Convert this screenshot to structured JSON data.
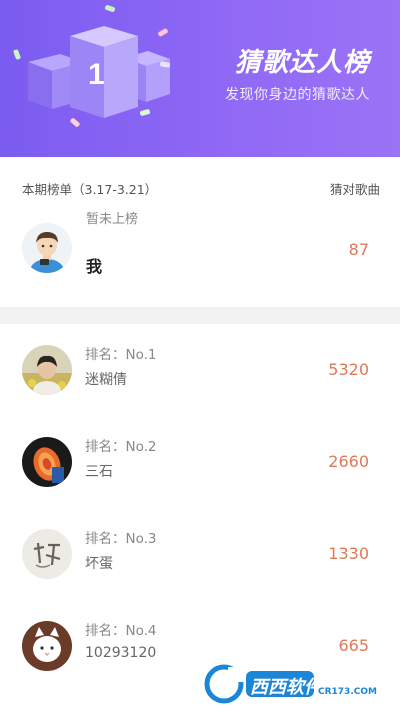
{
  "banner": {
    "title": "猜歌达人榜",
    "subtitle": "发现你身边的猜歌达人",
    "podium_number": "1"
  },
  "header": {
    "period": "本期榜单（3.17-3.21）",
    "count_label": "猜对歌曲"
  },
  "me": {
    "status": "暂未上榜",
    "name": "我",
    "score": "87"
  },
  "ranks": [
    {
      "rank": "排名：No.1",
      "name": "迷糊倩",
      "score": "5320"
    },
    {
      "rank": "排名：No.2",
      "name": "三石",
      "score": "2660"
    },
    {
      "rank": "排名：No.3",
      "name": "坏蛋",
      "score": "1330"
    },
    {
      "rank": "排名：No.4",
      "name": "10293120",
      "score": "665"
    }
  ],
  "watermark": {
    "brand": "西西软件园",
    "url": "CR173.COM"
  },
  "colors": {
    "banner_start": "#7b5cf0",
    "banner_end": "#9b73f6",
    "score": "#e07858"
  }
}
